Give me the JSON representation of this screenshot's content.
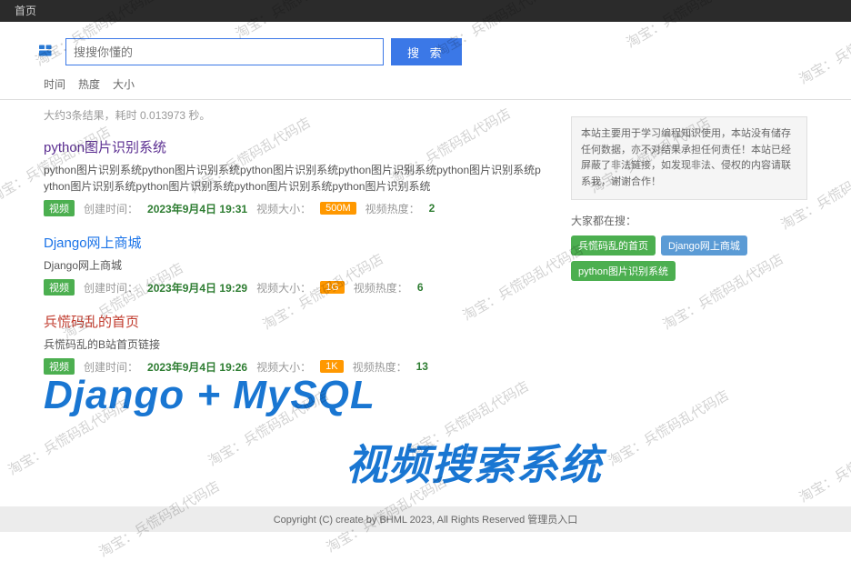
{
  "topbar": {
    "home": "首页"
  },
  "search": {
    "placeholder": "搜搜你懂的",
    "button": "搜 索"
  },
  "filters": {
    "time": "时间",
    "heat": "热度",
    "size": "大小"
  },
  "stats": "大约3条结果，耗时 0.013973 秒。",
  "results": [
    {
      "title": "python图片识别系统",
      "titleClass": "",
      "desc": "python图片识别系统python图片识别系统python图片识别系统python图片识别系统python图片识别系统python图片识别系统python图片识别系统python图片识别系统python图片识别系统",
      "type": "视频",
      "createLabel": "创建时间：",
      "create": "2023年9月4日 19:31",
      "sizeLabel": "视频大小：",
      "size": "500M",
      "heatLabel": "视频热度：",
      "heat": "2"
    },
    {
      "title": "Django网上商城",
      "titleClass": "blue",
      "desc": "Django网上商城",
      "type": "视频",
      "createLabel": "创建时间：",
      "create": "2023年9月4日 19:29",
      "sizeLabel": "视频大小：",
      "size": "1G",
      "heatLabel": "视频热度：",
      "heat": "6"
    },
    {
      "title": "兵慌码乱的首页",
      "titleClass": "red",
      "desc": "兵慌码乱的B站首页链接",
      "type": "视频",
      "createLabel": "创建时间：",
      "create": "2023年9月4日 19:26",
      "sizeLabel": "视频大小：",
      "size": "1K",
      "heatLabel": "视频热度：",
      "heat": "13"
    }
  ],
  "sidebar": {
    "notice": "本站主要用于学习编程知识使用，本站没有储存任何数据，亦不对结果承担任何责任！本站已经屏蔽了非法链接，如发现非法、侵权的内容请联系我，谢谢合作！",
    "tagTitle": "大家都在搜：",
    "tags": [
      {
        "label": "兵慌码乱的首页",
        "cls": "green"
      },
      {
        "label": "Django网上商城",
        "cls": "blue"
      },
      {
        "label": "python图片识别系统",
        "cls": "green"
      }
    ]
  },
  "overlay": {
    "line1": "Django + MySQL",
    "line2": "视频搜索系统"
  },
  "footer": "Copyright (C)  create by BHML 2023, All Rights Reserved  管理员入口",
  "watermark": "淘宝：兵慌码乱代码店"
}
